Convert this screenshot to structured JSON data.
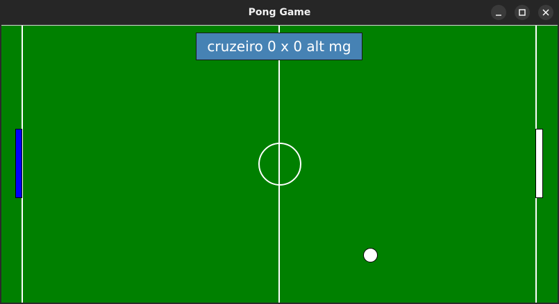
{
  "window": {
    "title": "Pong Game"
  },
  "scoreboard": {
    "text": "cruzeiro 0 x 0 alt mg"
  },
  "colors": {
    "field": "#008000",
    "lines": "#ffffff",
    "left_paddle": "#0000ff",
    "right_paddle": "#ffffff",
    "ball": "#ffffff",
    "scoreboard_bg": "#4682b4"
  },
  "icons": {
    "minimize": "minimize-icon",
    "maximize": "maximize-icon",
    "close": "close-icon"
  }
}
